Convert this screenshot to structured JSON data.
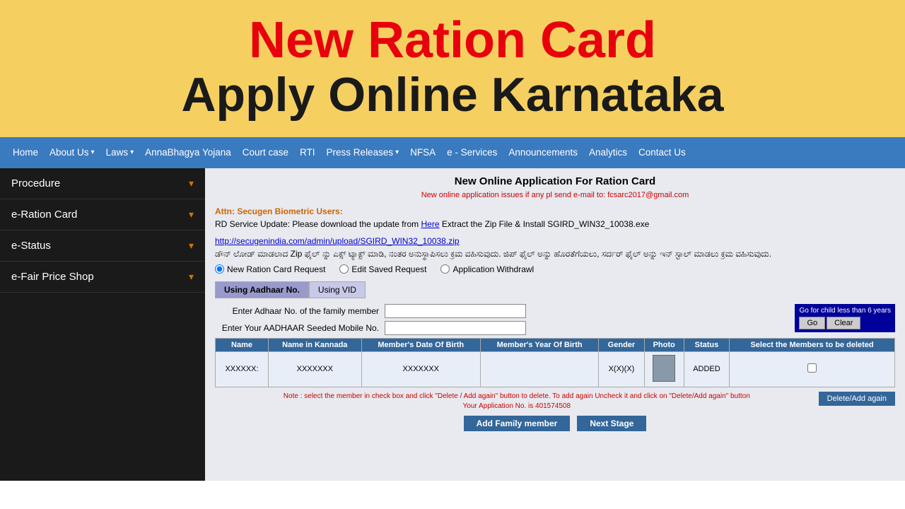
{
  "hero": {
    "line1": "New Ration Card",
    "line2": "Apply Online Karnataka"
  },
  "nav": {
    "items": [
      {
        "label": "Home",
        "hasDropdown": false
      },
      {
        "label": "About Us",
        "hasDropdown": true
      },
      {
        "label": "Laws",
        "hasDropdown": true
      },
      {
        "label": "AnnaBhagya Yojana",
        "hasDropdown": false
      },
      {
        "label": "Court case",
        "hasDropdown": false
      },
      {
        "label": "RTI",
        "hasDropdown": false
      },
      {
        "label": "Press Releases",
        "hasDropdown": true
      },
      {
        "label": "NFSA",
        "hasDropdown": false
      },
      {
        "label": "e - Services",
        "hasDropdown": false
      },
      {
        "label": "Announcements",
        "hasDropdown": false
      },
      {
        "label": "Analytics",
        "hasDropdown": false
      },
      {
        "label": "Contact Us",
        "hasDropdown": false
      }
    ]
  },
  "sidebar": {
    "items": [
      {
        "label": "Procedure",
        "hasDropdown": true
      },
      {
        "label": "e-Ration Card",
        "hasDropdown": true
      },
      {
        "label": "e-Status",
        "hasDropdown": true
      },
      {
        "label": "e-Fair Price Shop",
        "hasDropdown": true
      }
    ]
  },
  "form": {
    "title": "New Online Application For Ration Card",
    "notice_email": "New online application issues if any pl send e-mail to: fcsarc2017@gmail.com",
    "attn_label": "Attn: Secugen Biometric Users:",
    "rd_service_text": "RD Service Update: Please download the update from",
    "here_link": "Here",
    "rd_service_text2": "Extract the Zip File & Install SGIRD_WIN32_10038.exe",
    "kannada_link": "http://secugenindia.com/admin/upload/SGIRD_WIN32_10038.zip",
    "kannada_text": "ಡೌನ್ ಲೋಡ್ ಮಾಡಲಾದ Zip ಫೈಲ್ ನ್ನು ಎಕ್ಸ್ ಟ್ಯಾಕ್ಟ್ ಮಾಡಿ, ನಂತರ ಅನುಸ್ಥಾಪಿಸಲು ಕ್ರಮ ವಹಿಸುವುದು. ಜಿಪ್ ಫೈಲ್ ಅನ್ನು ಹೊರತೆಗೆಯಲು, ಸರ್ದರ್ ಫೈಲ್ ಅನ್ನು ಇನ್ ಸ್ಟಾಲ್ ಮಾಡಲು ಕ್ರಮ ವಹಿಸುವುದು.",
    "radio_options": [
      {
        "label": "New Ration Card Request",
        "value": "new",
        "checked": true
      },
      {
        "label": "Edit Saved Request",
        "value": "edit",
        "checked": false
      },
      {
        "label": "Application Withdrawl",
        "value": "withdraw",
        "checked": false
      }
    ],
    "tabs": [
      {
        "label": "Using Aadhaar No.",
        "active": true
      },
      {
        "label": "Using VID",
        "active": false
      }
    ],
    "field1_label": "Enter Adhaar No. of the family member",
    "field2_label": "Enter Your AADHAAR Seeded Mobile No.",
    "go_clear_label": "Go for child less than 6 years",
    "go_btn": "Go",
    "clear_btn": "Clear",
    "table_headers": [
      "Name",
      "Name in Kannada",
      "Member's Date Of Birth",
      "Member's Year Of Birth",
      "Gender",
      "Photo",
      "Status",
      "Select the Members to be deleted"
    ],
    "table_row": {
      "name": "XXXXXX:",
      "name_kannada": "XXXXXXX",
      "dob": "XXXXXXX",
      "yob": "",
      "gender": "X(X)(X)",
      "status": "ADDED",
      "checkbox": false
    },
    "delete_note": "Note : select the member in check box and click \"Delete / Add again\" button to delete. To add again Uncheck it and click on \"Delete/Add again\" button\nYour Application No. is 401574508",
    "delete_add_btn": "Delete/Add again",
    "add_family_btn": "Add Family member",
    "next_stage_btn": "Next Stage"
  }
}
